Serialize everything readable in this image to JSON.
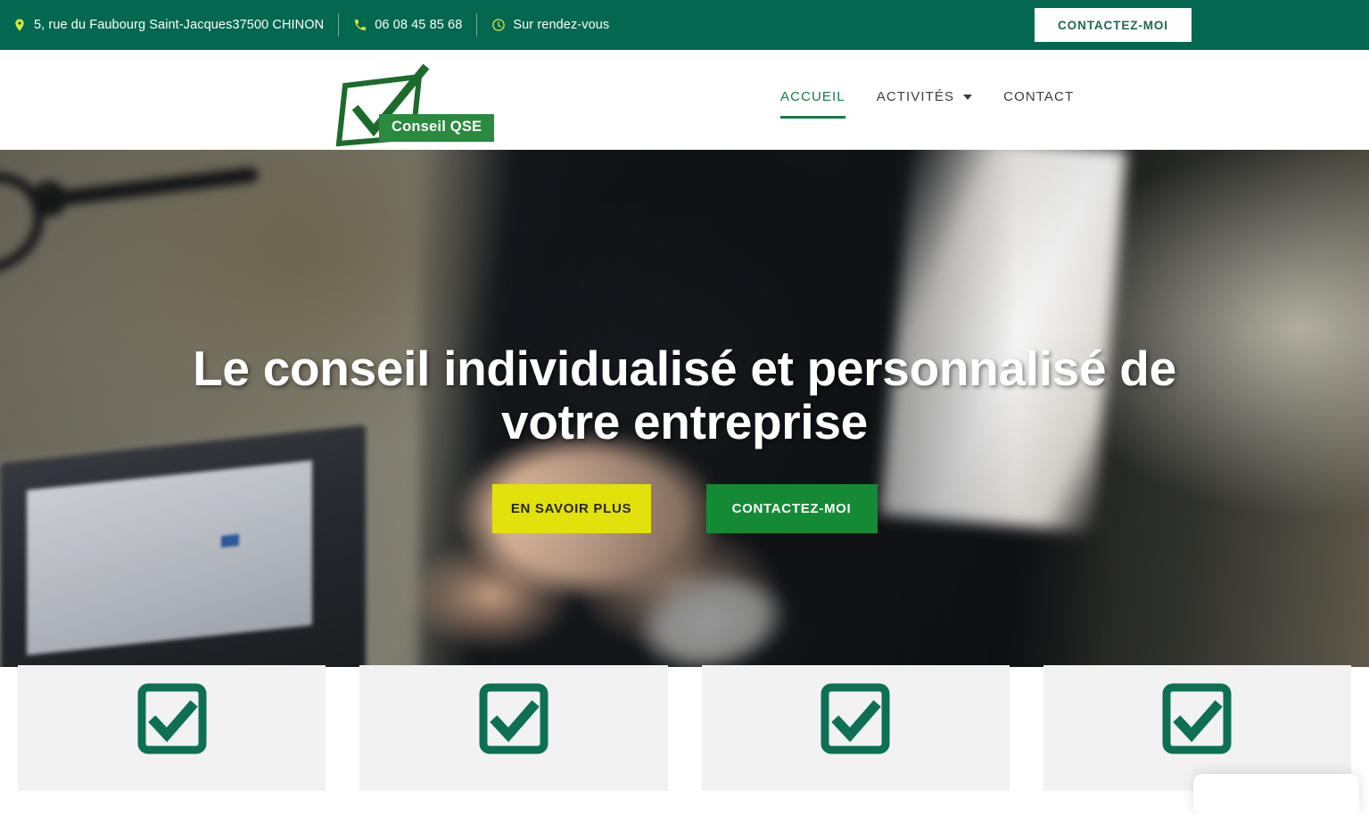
{
  "topbar": {
    "address": {
      "icon": "location-pin-icon",
      "text": "5, rue du Faubourg Saint-Jacques37500 CHINON"
    },
    "phone": {
      "icon": "phone-icon",
      "text": "06 08 45 85 68"
    },
    "hours": {
      "icon": "clock-icon",
      "text": "Sur rendez-vous"
    },
    "contact_button": "CONTACTEZ-MOI",
    "background_color": "#03684f",
    "icon_color": "#d8e83a"
  },
  "header": {
    "logo": {
      "badge_text": "Conseil QSE",
      "icon": "checkmark-box-logo-icon"
    },
    "nav": [
      {
        "label": "ACCUEIL",
        "active": true,
        "has_dropdown": false
      },
      {
        "label": "ACTIVITÉS",
        "active": false,
        "has_dropdown": true
      },
      {
        "label": "CONTACT",
        "active": false,
        "has_dropdown": false
      }
    ],
    "active_color": "#17794a"
  },
  "hero": {
    "title": "Le conseil individualisé et personnalisé de votre entreprise",
    "buttons": [
      {
        "label": "EN SAVOIR PLUS",
        "style": "yellow",
        "color": "#e3e10b"
      },
      {
        "label": "CONTACTEZ-MOI",
        "style": "green",
        "color": "#158a35"
      }
    ],
    "background_image": "business-handshake-photo"
  },
  "cards": [
    {
      "icon": "checkbox-check-icon",
      "color": "#0d7055"
    },
    {
      "icon": "checkbox-check-icon",
      "color": "#0d7055"
    },
    {
      "icon": "checkbox-check-icon",
      "color": "#0d7055"
    },
    {
      "icon": "checkbox-check-icon",
      "color": "#0d7055"
    }
  ],
  "chat_widget": {
    "visible": true
  }
}
